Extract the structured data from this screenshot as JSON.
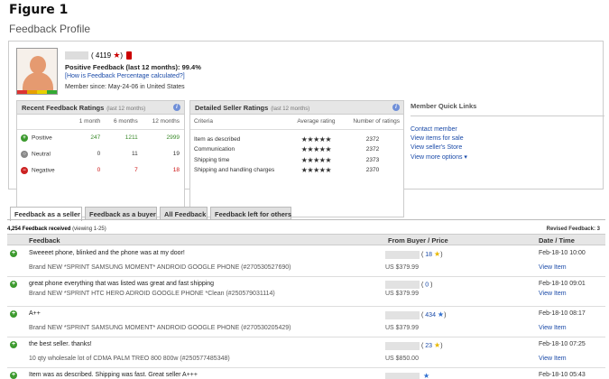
{
  "figure_label": "Figure 1",
  "page_title": "Feedback Profile",
  "profile": {
    "score": "( 4119",
    "score_close": ")",
    "positive_feedback": "Positive Feedback (last 12 months): 99.4%",
    "how_link": "[How is Feedback Percentage calculated?]",
    "member_since": "Member since: May-24-06 in United States"
  },
  "recent": {
    "title": "Recent Feedback Ratings",
    "subtitle": "(last 12 months)",
    "columns": [
      "1 month",
      "6 months",
      "12 months"
    ],
    "rows": [
      {
        "label": "Positive",
        "values": [
          "247",
          "1211",
          "2999"
        ],
        "color": "#3a8a2a"
      },
      {
        "label": "Neutral",
        "values": [
          "0",
          "11",
          "19"
        ],
        "color": "#333333"
      },
      {
        "label": "Negative",
        "values": [
          "0",
          "7",
          "18"
        ],
        "color": "#cc1111"
      }
    ]
  },
  "detailed": {
    "title": "Detailed Seller Ratings",
    "subtitle": "(last 12 months)",
    "col_criteria": "Criteria",
    "col_avg": "Average rating",
    "col_num": "Number of ratings",
    "rows": [
      {
        "criteria": "Item as described",
        "stars": 5,
        "count": "2372"
      },
      {
        "criteria": "Communication",
        "stars": 5,
        "count": "2372"
      },
      {
        "criteria": "Shipping time",
        "stars": 5,
        "count": "2373"
      },
      {
        "criteria": "Shipping and handling charges",
        "stars": 5,
        "count": "2370"
      }
    ]
  },
  "quick_links": {
    "title": "Member Quick Links",
    "links": [
      "Contact member",
      "View items for sale",
      "View seller's Store",
      "View more options"
    ]
  },
  "tabs": [
    "Feedback as a seller",
    "Feedback as a buyer",
    "All Feedback",
    "Feedback left for others"
  ],
  "feedback_count": "4,254 Feedback received",
  "viewing": "(viewing 1-25)",
  "revised": "Revised Feedback: 3",
  "columns": {
    "feedback": "Feedback",
    "from": "From Buyer / Price",
    "date": "Date / Time"
  },
  "entries": [
    {
      "comment": "Sweeeet phone, blinked and the phone was at my door!",
      "item": "Brand NEW *SPRINT SAMSUNG MOMENT* ANDROID GOOGLE PHONE (#270530527690)",
      "buyer_score": "18",
      "star": "yellow",
      "price": "US $379.99",
      "date": "Feb-18-10 10:00",
      "view": "View Item"
    },
    {
      "comment": "great phone everything that was listed was great and fast shipping",
      "item": "Brand NEW *SPRINT HTC HERO ADROID GOOGLE PHONE *Clean (#250579031114)",
      "buyer_score": "0",
      "star": "none",
      "price": "US $379.99",
      "date": "Feb-18-10 09:01",
      "view": "View Item"
    },
    {
      "comment": "A++",
      "item": "Brand NEW *SPRINT SAMSUNG MOMENT* ANDROID GOOGLE PHONE (#270530205429)",
      "buyer_score": "434",
      "star": "blue",
      "price": "US $379.99",
      "date": "Feb-18-10 08:17",
      "view": "View Item"
    },
    {
      "comment": "the best seller. thanks!",
      "item": "10 qty wholesale lot of CDMA PALM TREO 800 800w (#250577485348)",
      "buyer_score": "23",
      "star": "yellow",
      "price": "US $850.00",
      "date": "Feb-18-10 07:25",
      "view": "View Item"
    },
    {
      "comment": "Item was as described. Shipping was fast. Great seller A+++",
      "item": "",
      "buyer_score": "",
      "star": "blue",
      "price": "",
      "date": "Feb-18-10 05:43",
      "view": ""
    }
  ]
}
